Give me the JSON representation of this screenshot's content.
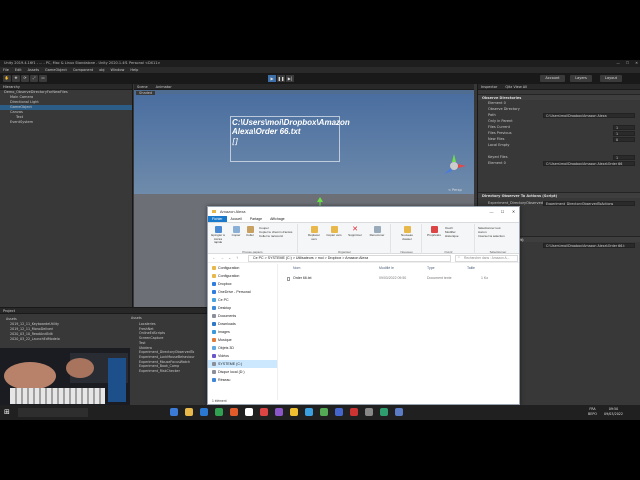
{
  "window": {
    "title": "Unity 2019.4.16f1 - ... - PC, Mac & Linux Standalone - Unity 2020.1.4f1 Personal <DX11>",
    "menu": [
      "File",
      "Edit",
      "Assets",
      "GameObject",
      "Component",
      "obj",
      "Window",
      "Help"
    ]
  },
  "toolbar": {
    "account_label": "Account",
    "layers_label": "Layers",
    "layout_label": "Layout"
  },
  "hierarchy": {
    "tab": "Hierarchy",
    "items": [
      "Demo_ObserveDirectoryForNewFiles",
      "Main Camera",
      "Directional Light",
      "GameObject",
      "Canvas",
      "Text",
      "EventSystem"
    ]
  },
  "scene": {
    "tabs": [
      "Scene",
      "Animator"
    ],
    "shading_label": "Shaded",
    "text": "C:\\Users\\moi\\Dropbox\\Amazon Alexa\\Order 66.txt",
    "cursor": "[]",
    "persp_label": "< Persp"
  },
  "inspector": {
    "tabs": [
      "Inspector",
      "Qitz View All"
    ],
    "rows": [
      {
        "label": "Observe Directories",
        "kind": "head"
      },
      {
        "label": "Element 0",
        "kind": "label"
      },
      {
        "label": "Observe Directory",
        "kind": "label"
      },
      {
        "label": "Path",
        "kind": "field",
        "value": "C:\\Users\\moi\\Dropbox\\Amazon Alexa"
      },
      {
        "label": "Only in Parent",
        "kind": "label"
      },
      {
        "label": "Files Current",
        "kind": "field",
        "value": "1"
      },
      {
        "label": "Files Previous",
        "kind": "field",
        "value": "1"
      },
      {
        "label": "New Files",
        "kind": "field",
        "value": "0"
      },
      {
        "label": "Local Empty",
        "kind": "label"
      },
      {
        "label": "Keyed Files",
        "kind": "field",
        "value": "1"
      },
      {
        "label": "Element 0",
        "kind": "field",
        "value": "C:\\Users\\moi\\Dropbox\\Amazon Alexa\\Order 66"
      },
      {
        "label": "Directory Observer To Actions (Script)",
        "kind": "head"
      },
      {
        "label": "Experiment_DirectoryObservedToActions.Path",
        "kind": "field",
        "value": "Experiment_DirectoryObservedToActions"
      },
      {
        "label": "Debug Meow (Script)",
        "kind": "head"
      },
      {
        "label": "Text",
        "kind": "field",
        "value": "C:\\Users\\moi\\Dropbox\\Amazon Alexa\\Order 66.t"
      }
    ]
  },
  "project": {
    "tab": "Project",
    "folders": [
      "Assets",
      "2019_12_11_KeyboardeUtility",
      "2019_12_11_MonoDeliveri",
      "2020_03_10_ReadAndEdit",
      "2020_03_22_LaunchEdModelo"
    ],
    "assets_header": "Assets",
    "asset_items": [
      "Localeries",
      "FreshNet",
      "OnlineEdScripts",
      "ScreenCapture",
      "Test",
      "Ubidera",
      "Experiment_DirectoryObservedTo",
      "Experiment_LockMouseBehaviour",
      "Experiment_MouseFocusWatch",
      "Experiment_Book_Comp",
      "Experiment_RiskChecker"
    ]
  },
  "explorer": {
    "title": "Amazon Alexa",
    "tabs": [
      "Fichier",
      "Accueil",
      "Partage",
      "Affichage"
    ],
    "ribbon": {
      "groups": [
        {
          "name": "Presse-papiers",
          "buttons": [
            "Epingler à Accès rapide",
            "Copier",
            "Coller"
          ],
          "small": [
            "Couper",
            "Copier le chemin d'accès",
            "Coller le raccourci"
          ]
        },
        {
          "name": "Organiser",
          "buttons": [
            "Déplacer vers",
            "Copier vers",
            "Supprimer",
            "Renommer"
          ],
          "small": []
        },
        {
          "name": "Nouveau",
          "buttons": [
            "Nouveau dossier"
          ],
          "small": []
        },
        {
          "name": "Ouvrir",
          "buttons": [
            "Propriétés"
          ],
          "small": [
            "Ouvrir",
            "Modifier",
            "Historique"
          ]
        },
        {
          "name": "Sélectionner",
          "buttons": [],
          "small": [
            "Sélectionner tout",
            "Aucun",
            "Inverser la sélection"
          ]
        }
      ]
    },
    "address": "Ce PC  >  SYSTEME (C:)  >  Utilisateurs  >  moi  >  Dropbox  >  Amazon Alexa",
    "search_placeholder": "Rechercher dans : Amazon A...",
    "nav": [
      {
        "label": "Configuration",
        "color": "#e8b84a"
      },
      {
        "label": "Configuration",
        "color": "#e8b84a"
      },
      {
        "label": "Dropbox",
        "color": "#2f7de1"
      },
      {
        "label": "OneDrive - Personal",
        "color": "#2f7de1"
      },
      {
        "label": "Ce PC",
        "color": "#4aa3df"
      },
      {
        "label": "Desktop",
        "color": "#3b8ad9"
      },
      {
        "label": "Documents",
        "color": "#8a8f99"
      },
      {
        "label": "Downloads",
        "color": "#2d76c8"
      },
      {
        "label": "Images",
        "color": "#3a9ad9"
      },
      {
        "label": "Musique",
        "color": "#e07b39"
      },
      {
        "label": "Objets 3D",
        "color": "#5fa8e0"
      },
      {
        "label": "Vidéos",
        "color": "#6b57c9"
      },
      {
        "label": "SYSTEME (C:)",
        "color": "#8a8f99"
      },
      {
        "label": "Disque local (D:)",
        "color": "#8a8f99"
      },
      {
        "label": "Réseau",
        "color": "#3f86d6"
      }
    ],
    "columns": [
      "Nom",
      "Modifié le",
      "Type",
      "Taille"
    ],
    "files": [
      {
        "name": "Order 66.txt",
        "modified": "09/03/2022 09:50",
        "type": "Document texte",
        "size": "1 Ko"
      }
    ],
    "status": "1 élément"
  },
  "taskbar": {
    "language": "FRA",
    "layout": "BEPO",
    "time": "09:50",
    "date": "09/03/2022"
  }
}
